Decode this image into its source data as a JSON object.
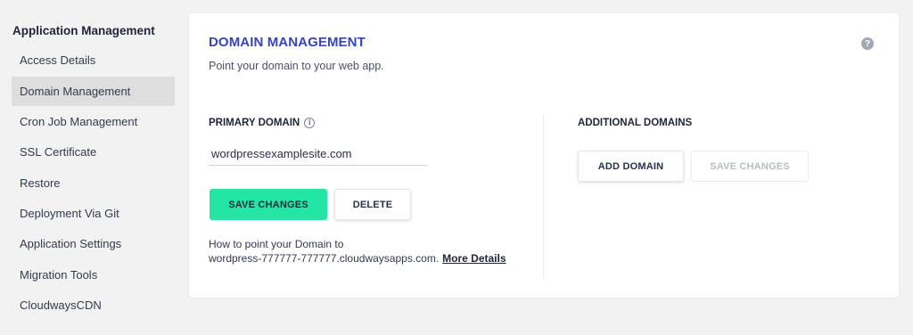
{
  "sidebar": {
    "title": "Application Management",
    "items": [
      {
        "label": "Access Details"
      },
      {
        "label": "Domain Management",
        "active": true
      },
      {
        "label": "Cron Job Management"
      },
      {
        "label": "SSL Certificate"
      },
      {
        "label": "Restore"
      },
      {
        "label": "Deployment Via Git"
      },
      {
        "label": "Application Settings"
      },
      {
        "label": "Migration Tools"
      },
      {
        "label": "CloudwaysCDN"
      }
    ]
  },
  "card": {
    "title": "DOMAIN MANAGEMENT",
    "subtitle": "Point your domain to your web app.",
    "help_icon": "question-circle-icon"
  },
  "primary": {
    "label": "PRIMARY DOMAIN",
    "info_icon": "info-circle-icon",
    "domain_value": "wordpressexamplesite.com",
    "save_label": "SAVE CHANGES",
    "delete_label": "DELETE",
    "howto_line1": "How to point your Domain to",
    "howto_line2": "wordpress-777777-777777.cloudwaysapps.com.",
    "more_details": "More Details"
  },
  "additional": {
    "label": "ADDITIONAL DOMAINS",
    "add_label": "ADD DOMAIN",
    "save_label": "SAVE CHANGES"
  },
  "colors": {
    "accent": "#3845b8",
    "primary_button": "#23e6a4",
    "background": "#f2f2f2"
  }
}
